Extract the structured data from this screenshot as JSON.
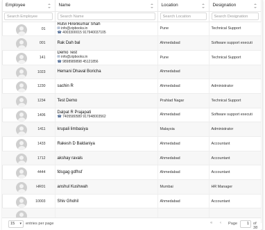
{
  "columns": [
    {
      "label": "Employee",
      "placeholder": "Search Employee"
    },
    {
      "label": "Name",
      "placeholder": "Search Name"
    },
    {
      "label": "Location",
      "placeholder": "Search Location"
    },
    {
      "label": "Designation",
      "placeholder": "Search Designation"
    }
  ],
  "rows": [
    {
      "id": "01",
      "name": "Rutvi Hirenkumar Shah",
      "email": "info@zipbooks.in",
      "phones": "4003300015   917940037105",
      "location": "Pune",
      "designation": "Technical Support"
    },
    {
      "id": "001",
      "name": "Rak Dah bal",
      "email": "",
      "phones": "",
      "location": "Ahmedabad",
      "designation": "Software support executi"
    },
    {
      "id": "141",
      "name": "Demo Test",
      "email": "info@zipbooks.in",
      "phones": "9898989898   45121856",
      "location": "Pune",
      "designation": "Technical Support"
    },
    {
      "id": "1023",
      "name": "Hemani Dhaval Boricha",
      "email": "",
      "phones": "",
      "location": "Ahmedabad",
      "designation": ""
    },
    {
      "id": "1230",
      "name": "sachin R",
      "email": "",
      "phones": "",
      "location": "Ahmedabad",
      "designation": "Administrator"
    },
    {
      "id": "1234",
      "name": "Test Demo",
      "email": "",
      "phones": "",
      "location": "Prahlad Nagar",
      "designation": "Technical Support"
    },
    {
      "id": "1406",
      "name": "Dalpat R Prajapati",
      "email": "",
      "phones": "7405580589   917948003562",
      "location": "Ahmedabad",
      "designation": "Software support executi"
    },
    {
      "id": "1411",
      "name": "krupali limbasiya",
      "email": "",
      "phones": "",
      "location": "Malaysia",
      "designation": "Administrator"
    },
    {
      "id": "1433",
      "name": "Rakesh D Baldaniya",
      "email": "",
      "phones": "",
      "location": "Ahmedabad",
      "designation": "Accountant"
    },
    {
      "id": "1712",
      "name": "akshay ravals",
      "email": "",
      "phones": "",
      "location": "Ahmedabad",
      "designation": "Accountant"
    },
    {
      "id": "4444",
      "name": "fdsgag gdfhsf",
      "email": "",
      "phones": "",
      "location": "Ahmedabad",
      "designation": "Accountant"
    },
    {
      "id": "HR01",
      "name": "anshul Kushwah",
      "email": "",
      "phones": "",
      "location": "Mumbai",
      "designation": "HR Manager"
    },
    {
      "id": "10003",
      "name": "Shiv Ghohil",
      "email": "",
      "phones": "",
      "location": "Ahmedabad",
      "designation": "Accountant"
    },
    {
      "id": "",
      "name": "",
      "email": "",
      "phones": "",
      "location": "",
      "designation": ""
    }
  ],
  "footer": {
    "page_size": "15",
    "entries_label": "entries per page",
    "page_label": "Page",
    "page_value": "1",
    "of_label": "of 38"
  },
  "icons": {
    "email": "mail-icon",
    "phone": "phone-icon",
    "sort": "sort-icon",
    "avatar": "avatar-icon"
  }
}
